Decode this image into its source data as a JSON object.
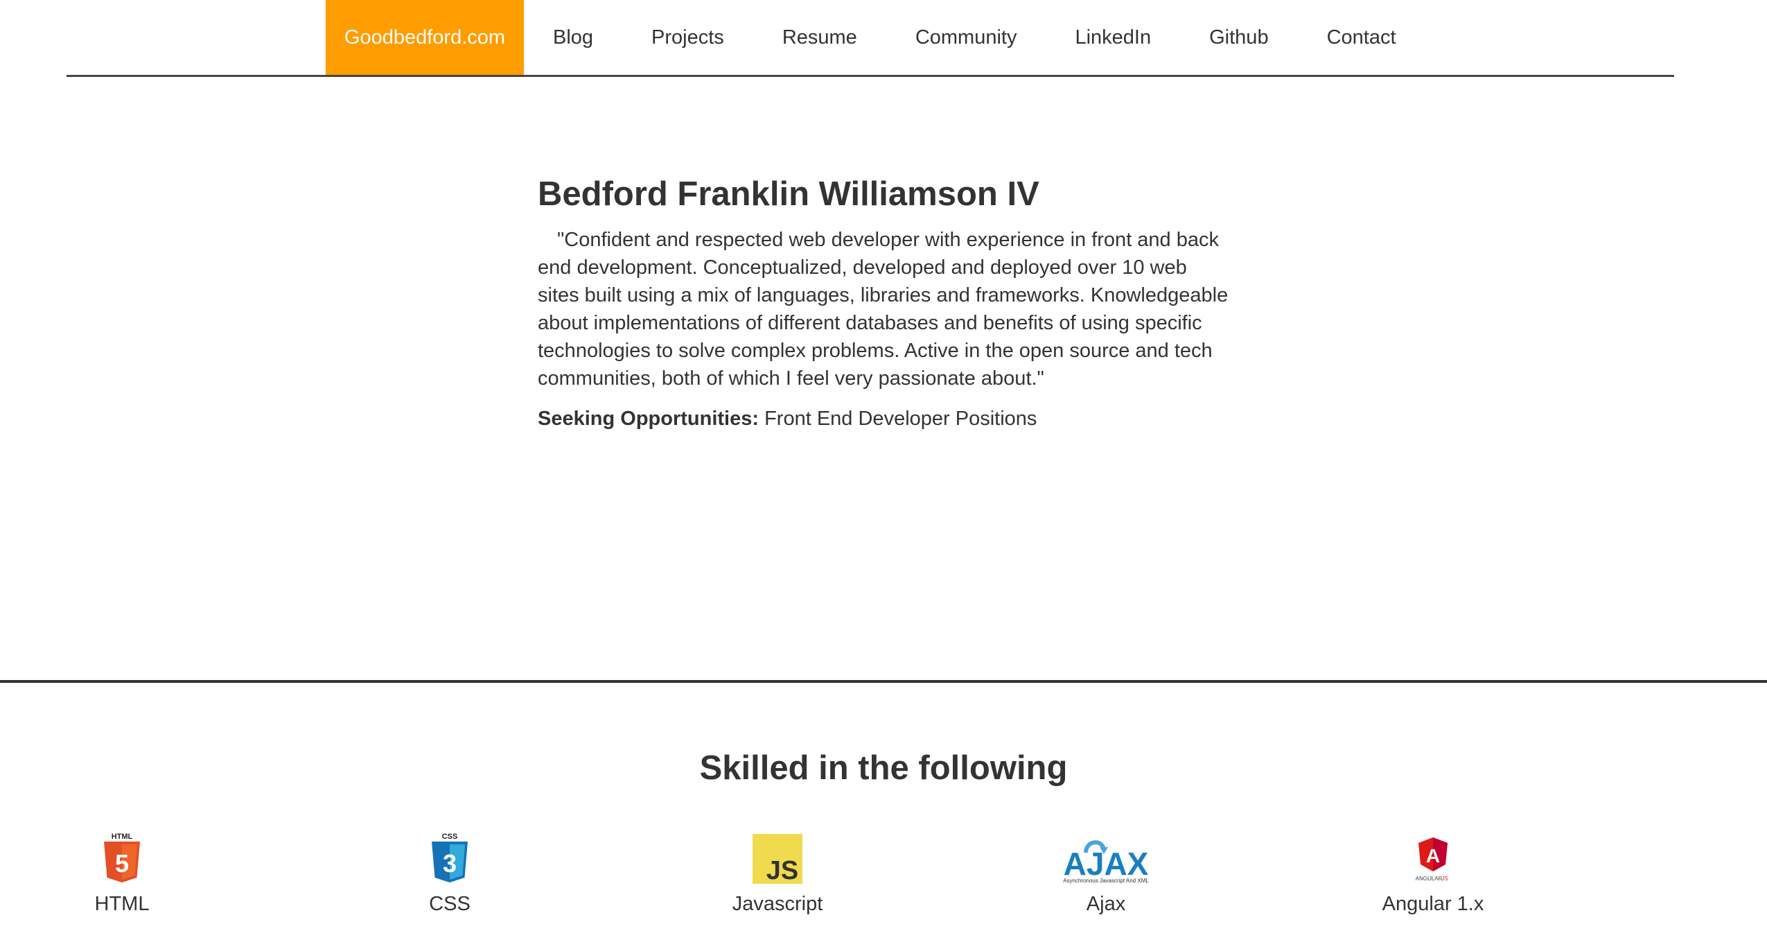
{
  "nav": {
    "brand": "Goodbedford.com",
    "links": [
      "Blog",
      "Projects",
      "Resume",
      "Community",
      "LinkedIn",
      "Github",
      "Contact"
    ]
  },
  "profile": {
    "name": "Bedford Franklin Williamson IV",
    "quote": "\"Confident and respected web developer with experience in front and back end development. Conceptualized, developed and deployed over 10 web sites built using a mix of languages, libraries and frameworks. Knowledgeable about implementations of different databases and benefits of using specific technologies to solve complex problems. Active in the open source and tech communities, both of which I feel very passionate about.\"",
    "seeking_label": "Seeking Opportunities:",
    "seeking_value": "Front End Developer Positions"
  },
  "skills": {
    "title": "Skilled in the following",
    "items": [
      {
        "label": "HTML",
        "icon": "html5-icon",
        "icon_text": "HTML",
        "icon_glyph": "5"
      },
      {
        "label": "CSS",
        "icon": "css3-icon",
        "icon_text": "CSS",
        "icon_glyph": "3"
      },
      {
        "label": "Javascript",
        "icon": "javascript-icon",
        "icon_glyph": "JS"
      },
      {
        "label": "Ajax",
        "icon": "ajax-icon",
        "icon_glyph": "AJAX",
        "icon_subtext": "Asynchronous Javascript And XML"
      },
      {
        "label": "Angular 1.x",
        "icon": "angularjs-icon",
        "icon_glyph": "A",
        "icon_text": "ANGULAR",
        "icon_text_accent": "JS"
      }
    ]
  },
  "colors": {
    "brand_bg": "#ff9c00",
    "text": "#333333",
    "html5_orange": "#e34f26",
    "css3_blue": "#1572b6",
    "js_yellow": "#f0db4f",
    "ajax_blue": "#1a7fc1",
    "angular_red": "#dd1b16"
  }
}
